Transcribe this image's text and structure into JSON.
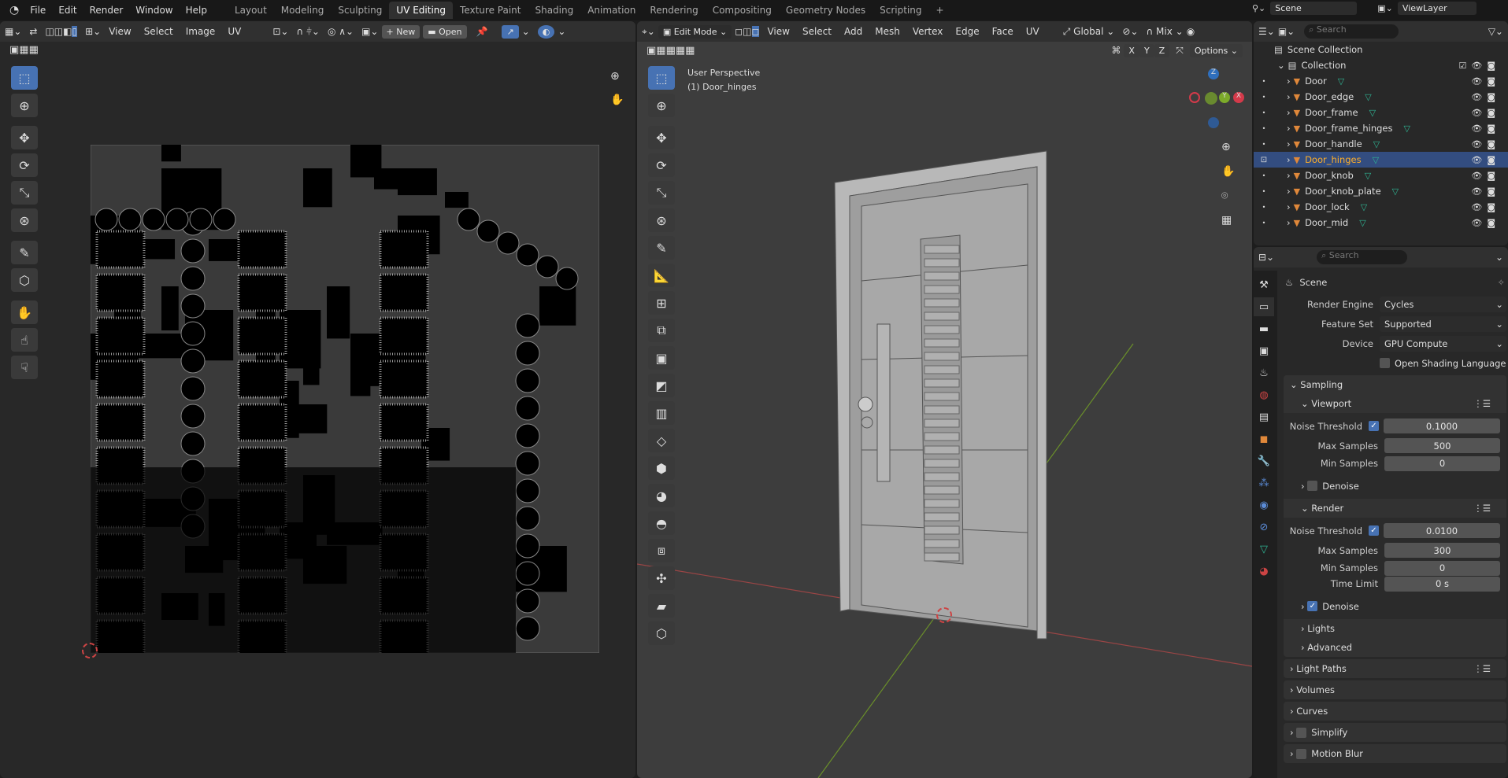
{
  "menubar": {
    "items": [
      "File",
      "Edit",
      "Render",
      "Window",
      "Help"
    ],
    "workspaces": [
      "Layout",
      "Modeling",
      "Sculpting",
      "UV Editing",
      "Texture Paint",
      "Shading",
      "Animation",
      "Rendering",
      "Compositing",
      "Geometry Nodes",
      "Scripting"
    ],
    "active_workspace": "UV Editing",
    "add_label": "+",
    "scene": "Scene",
    "view_layer": "ViewLayer"
  },
  "uv_editor": {
    "menus": [
      "View",
      "Select",
      "Image",
      "UV"
    ],
    "new_label": "New",
    "open_label": "Open"
  },
  "viewport": {
    "mode": "Edit Mode",
    "menus": [
      "View",
      "Select",
      "Add",
      "Mesh",
      "Vertex",
      "Edge",
      "Face",
      "UV"
    ],
    "orientation": "Global",
    "snap": "Mix",
    "options_label": "Options",
    "axes": [
      "X",
      "Y",
      "Z"
    ],
    "overlay_title": "User Perspective",
    "overlay_object": "(1) Door_hinges",
    "gizmo": {
      "x": "X",
      "y": "Y",
      "z": "Z"
    }
  },
  "outliner": {
    "search_placeholder": "Search",
    "scene_collection": "Scene Collection",
    "collection": "Collection",
    "objects": [
      "Door",
      "Door_edge",
      "Door_frame",
      "Door_frame_hinges",
      "Door_handle",
      "Door_hinges",
      "Door_knob",
      "Door_knob_plate",
      "Door_lock",
      "Door_mid"
    ],
    "selected": "Door_hinges"
  },
  "properties": {
    "search_placeholder": "Search",
    "context": "Scene",
    "render_engine": {
      "label": "Render Engine",
      "value": "Cycles"
    },
    "feature_set": {
      "label": "Feature Set",
      "value": "Supported"
    },
    "device": {
      "label": "Device",
      "value": "GPU Compute"
    },
    "osl": {
      "label": "Open Shading Language",
      "checked": false
    },
    "sampling": {
      "title": "Sampling",
      "viewport": {
        "title": "Viewport",
        "noise_label": "Noise Threshold",
        "noise": "0.1000",
        "max_label": "Max Samples",
        "max": "500",
        "min_label": "Min Samples",
        "min": "0",
        "denoise": "Denoise"
      },
      "render": {
        "title": "Render",
        "noise_label": "Noise Threshold",
        "noise": "0.0100",
        "max_label": "Max Samples",
        "max": "300",
        "min_label": "Min Samples",
        "min": "0",
        "time_label": "Time Limit",
        "time": "0 s",
        "denoise": "Denoise"
      },
      "lights": "Lights",
      "advanced": "Advanced"
    },
    "panels": [
      "Light Paths",
      "Volumes",
      "Curves",
      "Simplify",
      "Motion Blur"
    ]
  },
  "colors": {
    "accent": "#4772b3",
    "selected_row": "#334d80",
    "object_orange": "#e0883a",
    "mesh_green": "#2fb594",
    "selected_text": "#ffaf29"
  }
}
